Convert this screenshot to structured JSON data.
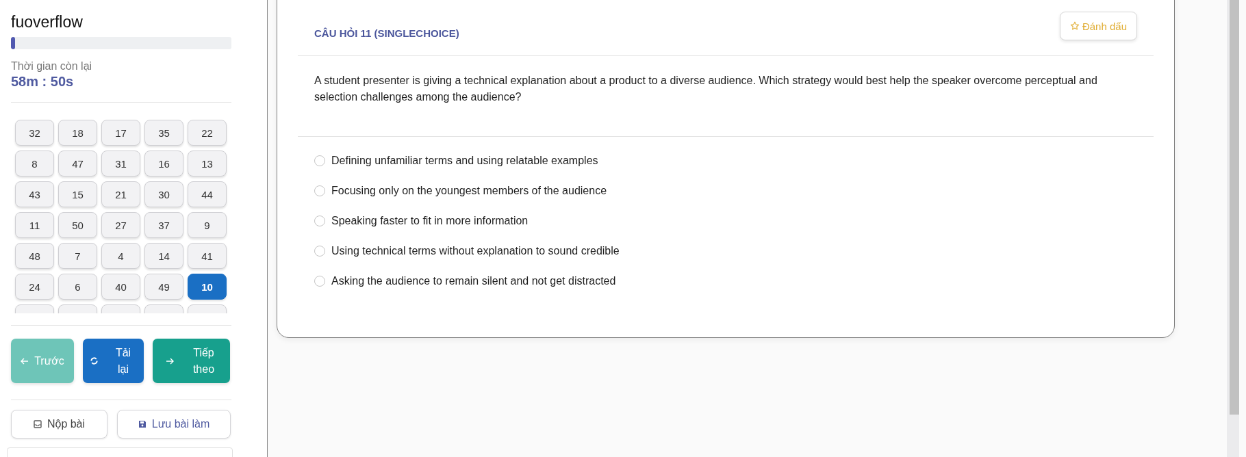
{
  "sidebar": {
    "title": "fuoverflow",
    "progress": {
      "level": 0.02
    },
    "timer": {
      "label": "Thời gian còn lại",
      "value": "58m : 50s"
    },
    "questions": [
      {
        "label": "32",
        "selected": false
      },
      {
        "label": "18",
        "selected": false
      },
      {
        "label": "17",
        "selected": false
      },
      {
        "label": "35",
        "selected": false
      },
      {
        "label": "22",
        "selected": false
      },
      {
        "label": "8",
        "selected": false
      },
      {
        "label": "47",
        "selected": false
      },
      {
        "label": "31",
        "selected": false
      },
      {
        "label": "16",
        "selected": false
      },
      {
        "label": "13",
        "selected": false
      },
      {
        "label": "43",
        "selected": false
      },
      {
        "label": "15",
        "selected": false
      },
      {
        "label": "21",
        "selected": false
      },
      {
        "label": "30",
        "selected": false
      },
      {
        "label": "44",
        "selected": false
      },
      {
        "label": "11",
        "selected": false
      },
      {
        "label": "50",
        "selected": false
      },
      {
        "label": "27",
        "selected": false
      },
      {
        "label": "37",
        "selected": false
      },
      {
        "label": "9",
        "selected": false
      },
      {
        "label": "48",
        "selected": false
      },
      {
        "label": "7",
        "selected": false
      },
      {
        "label": "4",
        "selected": false
      },
      {
        "label": "14",
        "selected": false
      },
      {
        "label": "41",
        "selected": false
      },
      {
        "label": "24",
        "selected": false
      },
      {
        "label": "6",
        "selected": false
      },
      {
        "label": "40",
        "selected": false
      },
      {
        "label": "49",
        "selected": false
      },
      {
        "label": "10",
        "selected": true
      },
      {
        "selected": false
      },
      {
        "selected": false
      },
      {
        "selected": false
      },
      {
        "selected": false
      },
      {
        "selected": false
      }
    ],
    "nav_buttons": [
      {
        "kind": "prev",
        "label": "Trước"
      },
      {
        "kind": "reload",
        "label": "Tải lại"
      },
      {
        "kind": "next",
        "label": "Tiếp theo"
      }
    ],
    "action_buttons": [
      {
        "kind": "submit",
        "label": "Nộp bài"
      },
      {
        "kind": "save",
        "label": "Lưu bài làm"
      }
    ]
  },
  "question": {
    "header": "CÂU HỎI 11 (SINGLECHOICE)",
    "bookmark": "Đánh dấu",
    "text": "A student presenter is giving a technical explanation about a product to a diverse audience. Which strategy would best help the speaker overcome perceptual and selection challenges among the audience?",
    "options": [
      {
        "label": "Defining unfamiliar terms and using relatable examples",
        "selected": false
      },
      {
        "label": "Focusing only on the youngest members of the audience",
        "selected": false
      },
      {
        "label": "Speaking faster to fit in more information",
        "selected": false
      },
      {
        "label": "Using technical terms without explanation to sound credible",
        "selected": false
      },
      {
        "label": "Asking the audience to remain silent and not get distracted",
        "selected": false
      }
    ]
  }
}
